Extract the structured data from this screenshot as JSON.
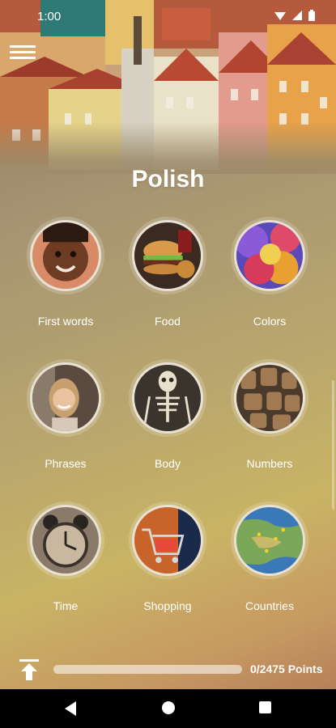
{
  "status": {
    "time": "1:00"
  },
  "app": {
    "title": "Polish"
  },
  "categories": [
    {
      "label": "First words",
      "icon": "child-face-icon"
    },
    {
      "label": "Food",
      "icon": "burger-icon"
    },
    {
      "label": "Colors",
      "icon": "color-powder-icon"
    },
    {
      "label": "Phrases",
      "icon": "smiling-woman-icon"
    },
    {
      "label": "Body",
      "icon": "skeleton-icon"
    },
    {
      "label": "Numbers",
      "icon": "wooden-numbers-icon"
    },
    {
      "label": "Time",
      "icon": "alarm-clock-icon"
    },
    {
      "label": "Shopping",
      "icon": "shopping-cart-icon"
    },
    {
      "label": "Countries",
      "icon": "world-map-icon"
    }
  ],
  "progress": {
    "text": "0/2475 Points",
    "fraction": 0
  },
  "colors": {
    "accent": "#ffffff",
    "background": "#b8a56e"
  }
}
